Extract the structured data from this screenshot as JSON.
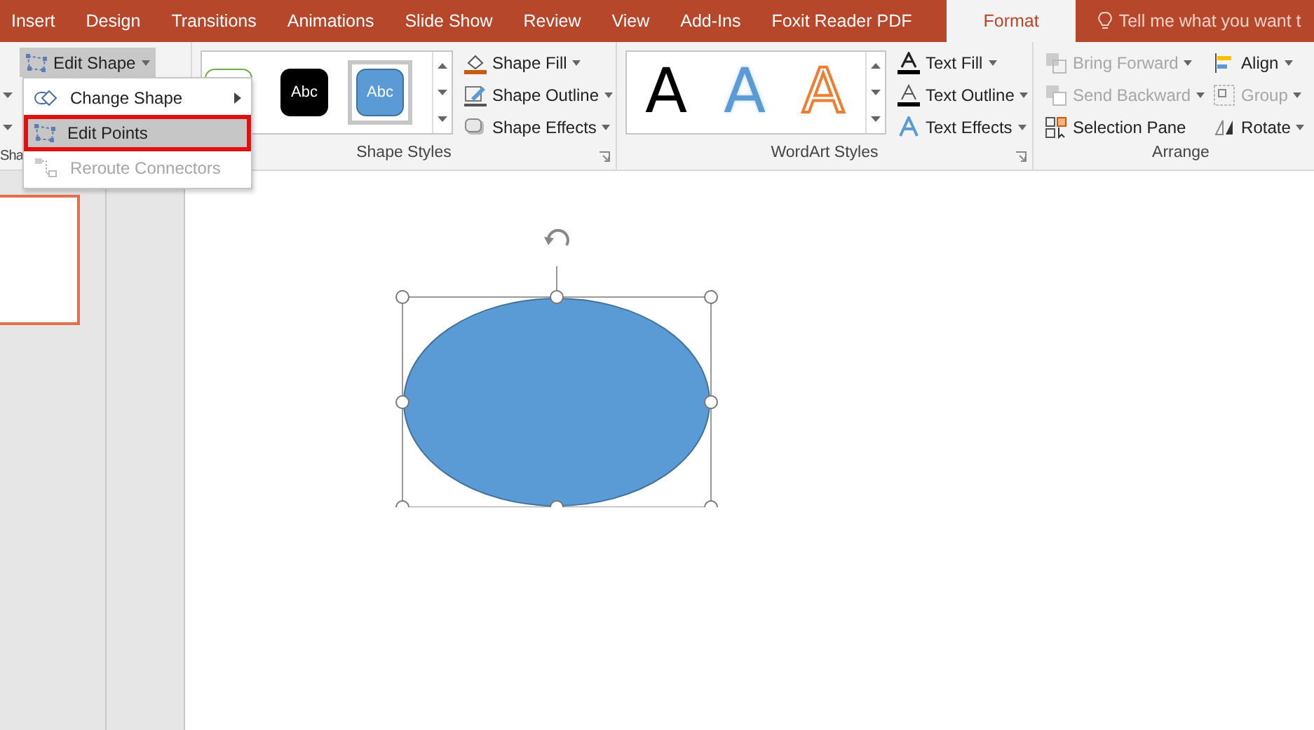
{
  "tabs": [
    {
      "label": "Insert",
      "selected": false
    },
    {
      "label": "Design",
      "selected": false
    },
    {
      "label": "Transitions",
      "selected": false
    },
    {
      "label": "Animations",
      "selected": false
    },
    {
      "label": "Slide Show",
      "selected": false
    },
    {
      "label": "Review",
      "selected": false
    },
    {
      "label": "View",
      "selected": false
    },
    {
      "label": "Add-Ins",
      "selected": false
    },
    {
      "label": "Foxit Reader PDF",
      "selected": false
    },
    {
      "label": "Format",
      "selected": true
    }
  ],
  "tell_me": {
    "placeholder": "Tell me what you want t"
  },
  "insert_shapes_group": {
    "label": "Sha",
    "edit_shape_button": {
      "label": "Edit Shape",
      "expanded": true
    }
  },
  "edit_shape_menu": [
    {
      "label": "Change Shape",
      "kind": "submenu",
      "selected": false,
      "disabled": false
    },
    {
      "label": "Edit Points",
      "kind": "item",
      "selected": true,
      "disabled": false
    },
    {
      "label": "Reroute Connectors",
      "kind": "item",
      "selected": false,
      "disabled": true
    }
  ],
  "shape_styles": {
    "label": "Shape Styles",
    "gallery": [
      {
        "kind": "outline",
        "selected": false
      },
      {
        "text": "Abc",
        "kind": "dark",
        "selected": false
      },
      {
        "text": "Abc",
        "kind": "accent",
        "selected": true
      }
    ],
    "commands": [
      {
        "label": "Shape Fill",
        "kind": "fill"
      },
      {
        "label": "Shape Outline",
        "kind": "outline"
      },
      {
        "label": "Shape Effects",
        "kind": "effects"
      }
    ]
  },
  "wordart_styles": {
    "label": "WordArt Styles",
    "gallery": [
      {
        "text": "A",
        "kind": "solid"
      },
      {
        "text": "A",
        "kind": "glow"
      },
      {
        "text": "A",
        "kind": "outline"
      }
    ],
    "commands": [
      {
        "label": "Text Fill",
        "kind": "fill"
      },
      {
        "label": "Text Outline",
        "kind": "outline"
      },
      {
        "label": "Text Effects",
        "kind": "effects"
      }
    ]
  },
  "arrange": {
    "label": "Arrange",
    "commands": [
      {
        "label": "Bring Forward",
        "kind": "forward",
        "disabled": true
      },
      {
        "label": "Send Backward",
        "kind": "backward",
        "disabled": true
      },
      {
        "label": "Selection Pane",
        "kind": "pane",
        "disabled": false
      },
      {
        "label": "Align",
        "kind": "align",
        "disabled": false
      },
      {
        "label": "Group",
        "kind": "group",
        "disabled": true
      },
      {
        "label": "Rotate",
        "kind": "rotate",
        "disabled": false
      }
    ]
  },
  "slide_thumbnail": {
    "selected": true
  },
  "shape": {
    "kind": "ellipse",
    "color": "#5b9bd5",
    "selected": true
  }
}
